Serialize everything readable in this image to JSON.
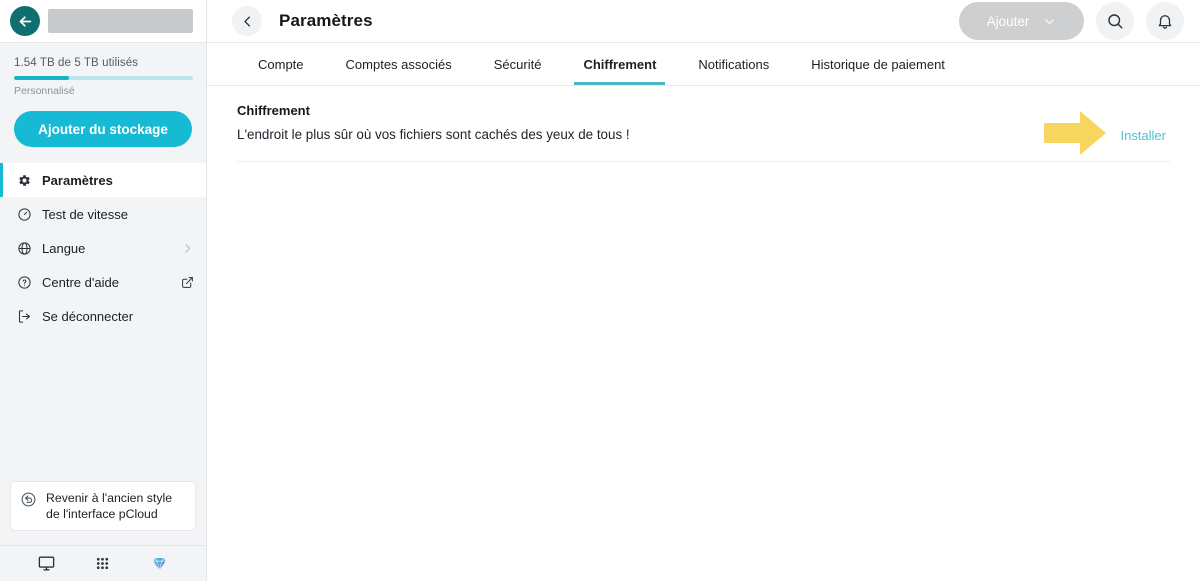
{
  "browser": {
    "back_icon": "arrow-left-icon",
    "address_placeholder": ""
  },
  "sidebar": {
    "storage": {
      "used_text": "1.54 TB de 5 TB utilisés",
      "plan_label": "Personnalisé",
      "percent_used": 31,
      "bar_fill_color": "#17b4c4",
      "bar_track_color": "#b9e6ea"
    },
    "add_storage_label": "Ajouter du stockage",
    "add_storage_color": "#16bad4",
    "items": [
      {
        "label": "Paramètres",
        "icon": "gear-icon",
        "active": true,
        "trailing": ""
      },
      {
        "label": "Test de vitesse",
        "icon": "speedometer-icon",
        "active": false,
        "trailing": ""
      },
      {
        "label": "Langue",
        "icon": "globe-icon",
        "active": false,
        "trailing": "chevron-right-icon"
      },
      {
        "label": "Centre d'aide",
        "icon": "question-circle-icon",
        "active": false,
        "trailing": "external-link-icon"
      },
      {
        "label": "Se déconnecter",
        "icon": "logout-icon",
        "active": false,
        "trailing": ""
      }
    ],
    "revert_label": "Revenir à l'ancien style de l'interface pCloud",
    "revert_icon": "revert-circle-icon",
    "bottom_icons": [
      {
        "name": "monitor-icon"
      },
      {
        "name": "apps-grid-icon"
      },
      {
        "name": "diamond-icon"
      }
    ]
  },
  "header": {
    "back_icon": "chevron-left-icon",
    "title": "Paramètres",
    "add_button_label": "Ajouter",
    "add_button_chevron": "chevron-down-icon",
    "search_icon": "search-icon",
    "notifications_icon": "bell-icon"
  },
  "tabs": [
    {
      "label": "Compte",
      "active": false
    },
    {
      "label": "Comptes associés",
      "active": false
    },
    {
      "label": "Sécurité",
      "active": false
    },
    {
      "label": "Chiffrement",
      "active": true
    },
    {
      "label": "Notifications",
      "active": false
    },
    {
      "label": "Historique de paiement",
      "active": false
    }
  ],
  "tab_underline_color": "#4db6c4",
  "content": {
    "row": {
      "title": "Chiffrement",
      "description": "L'endroit le plus sûr où vos fichiers sont cachés des yeux de tous !",
      "action_label": "Installer",
      "action_color": "#51bfd0"
    },
    "annotation": {
      "shape": "right-arrow-icon",
      "color": "#f7d660"
    }
  }
}
